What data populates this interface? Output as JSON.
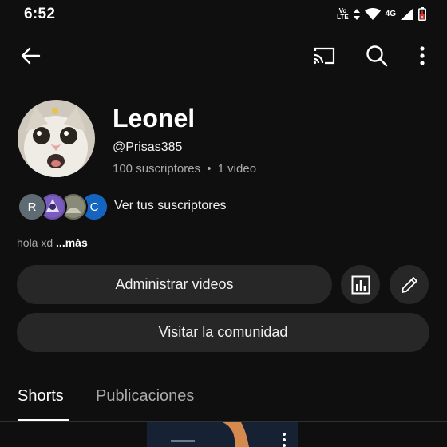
{
  "status_bar": {
    "time": "6:52",
    "volte_top": "Vo",
    "volte_bottom": "LTE",
    "network": "4G"
  },
  "top_bar": {
    "icons": [
      "back-arrow-icon",
      "cast-icon",
      "search-icon",
      "more-vert-icon"
    ]
  },
  "channel": {
    "name": "Leonel",
    "handle": "@Prisas385",
    "subscribers": "100 suscriptores",
    "separator": "•",
    "videos": "1 video"
  },
  "subscribers_preview": {
    "avatars": [
      {
        "letter": "R",
        "color": "#5f6b73"
      },
      {
        "letter": "",
        "color": "#6a4fa3"
      },
      {
        "letter": "",
        "color": "#6b6b5a"
      },
      {
        "letter": "C",
        "color": "#1565c0"
      }
    ],
    "link_label": "Ver tus suscriptores"
  },
  "description": {
    "text": "hola xd",
    "more": "...más"
  },
  "actions": {
    "manage_videos": "Administrar videos",
    "visit_community": "Visitar la comunidad"
  },
  "tabs": [
    {
      "label": "Shorts",
      "active": true
    },
    {
      "label": "Publicaciones",
      "active": false
    }
  ]
}
